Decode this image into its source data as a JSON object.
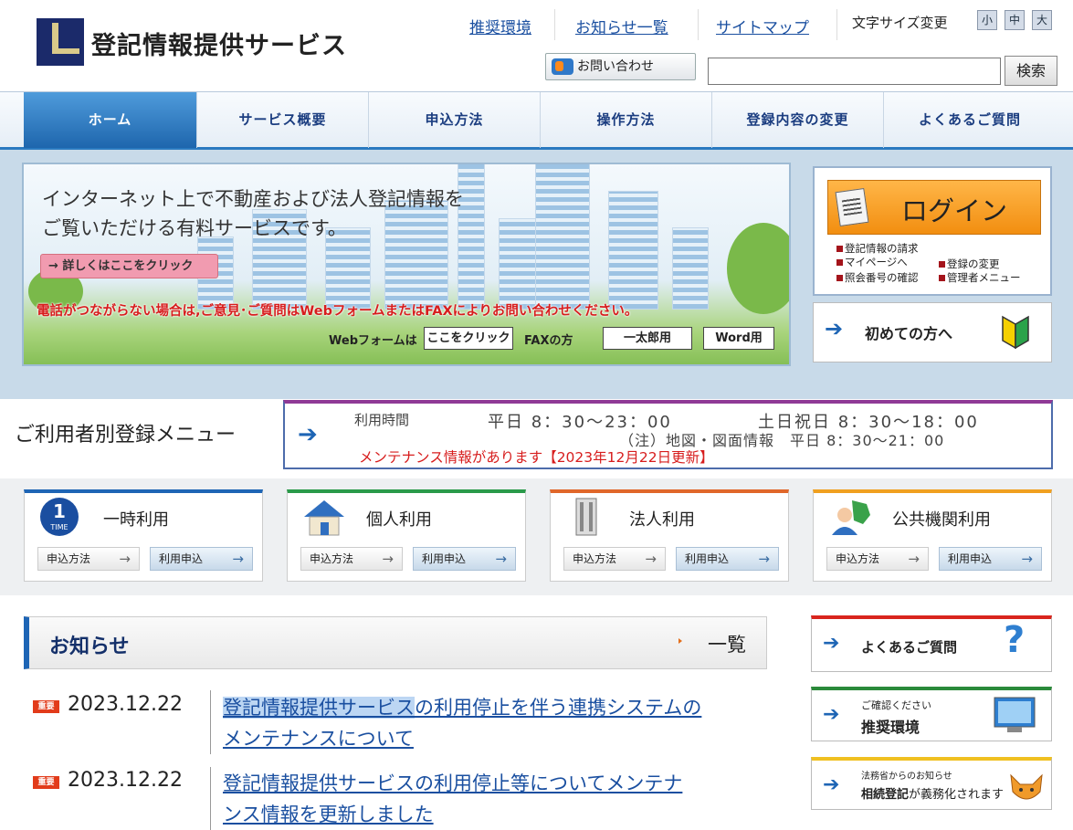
{
  "header": {
    "site_title": "登記情報提供サービス",
    "links": [
      "推奨環境",
      "お知らせ一覧",
      "サイトマップ"
    ],
    "font_size_label": "文字サイズ変更",
    "font_sizes": [
      "小",
      "中",
      "大"
    ],
    "contact_label": "お問い合わせ",
    "search_value": "",
    "search_button": "検索"
  },
  "nav": {
    "items": [
      "ホーム",
      "サービス概要",
      "申込方法",
      "操作方法",
      "登録内容の変更",
      "よくあるご質問"
    ],
    "active_index": 0
  },
  "banner": {
    "heading_line1": "インターネット上で不動産および法人登記情報を",
    "heading_line2": "ご覧いただける有料サービスです。",
    "more_button": "→ 詳しくはここをクリック",
    "notice": "電話がつながらない場合は,ご意見･ご質問はWebフォームまたはFAXによりお問い合わせください。",
    "web_form_label": "Webフォームは",
    "web_form_button": "ここをクリック",
    "fax_label": "FAXの方",
    "fax_ichitaro": "一太郎用",
    "fax_word": "Word用"
  },
  "login": {
    "button": "ログイン",
    "links": [
      "登記情報の請求",
      "マイページへ",
      "登録の変更",
      "照会番号の確認",
      "管理者メニュー"
    ]
  },
  "first_time": {
    "label": "初めての方へ"
  },
  "registration": {
    "title": "ご利用者別登録メニュー",
    "hours_label": "利用時間",
    "weekday": "平日 8：30～23：00",
    "holiday": "土日祝日 8：30～18：00",
    "map_note": "（注）地図・図面情報　平日 8：30～21：00",
    "maintenance": "メンテナンス情報があります【2023年12月22日更新】"
  },
  "user_cards": [
    {
      "title": "一時利用",
      "method": "申込方法",
      "apply": "利用申込",
      "color": "#1e65b5",
      "icon": "one-time-icon",
      "badge": "1",
      "badge_sub": "TIME"
    },
    {
      "title": "個人利用",
      "method": "申込方法",
      "apply": "利用申込",
      "color": "#2a9a4a",
      "icon": "house-icon"
    },
    {
      "title": "法人利用",
      "method": "申込方法",
      "apply": "利用申込",
      "color": "#e0672a",
      "icon": "building-icon"
    },
    {
      "title": "公共機関利用",
      "method": "申込方法",
      "apply": "利用申込",
      "color": "#f0a020",
      "icon": "public-agency-icon"
    }
  ],
  "news": {
    "title": "お知らせ",
    "all_link": "一覧",
    "items": [
      {
        "badge": "重要",
        "date": "2023.12.22",
        "text_highlight": "登記情報提供サービス",
        "text_rest_line1": "の利用停止を伴う連携システムの",
        "text_line2": "メンテナンスについて"
      },
      {
        "badge": "重要",
        "date": "2023.12.22",
        "text_line1": "登記情報提供サービスの利用停止等についてメンテナ",
        "text_line2": "ンス情報を更新しました"
      }
    ]
  },
  "side_links": [
    {
      "label": "よくあるご質問",
      "color": "#d9251d"
    },
    {
      "small": "ご確認ください",
      "label": "推奨環境",
      "color": "#2a8a3a"
    },
    {
      "small": "法務省からのお知らせ",
      "label_bold": "相続登記",
      "label_rest": "が義務化されます",
      "color": "#f0c020"
    }
  ]
}
